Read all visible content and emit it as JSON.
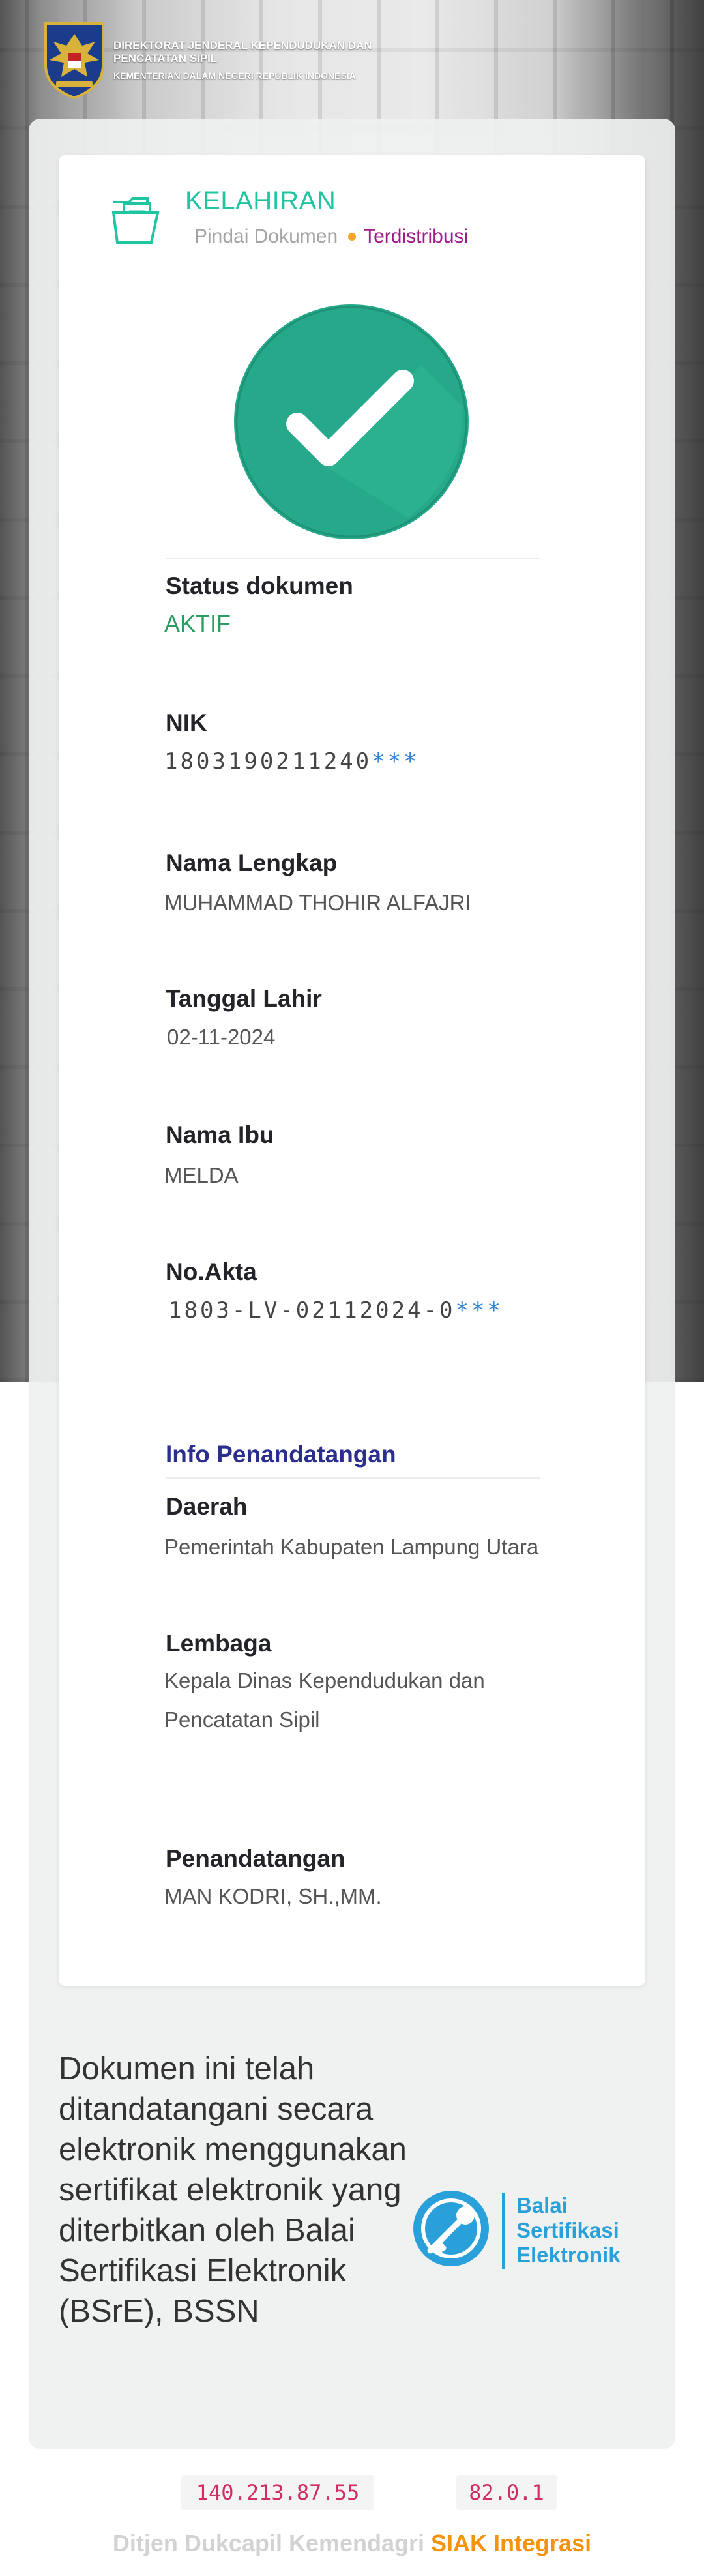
{
  "header": {
    "line1": "DIREKTORAT JENDERAL KEPENDUDUKAN DAN PENCATATAN SIPIL",
    "line2": "KEMENTERIAN DALAM NEGERI REPUBLIK INDONESIA",
    "emblem_icon": "garuda-emblem-icon"
  },
  "card": {
    "title": "KELAHIRAN",
    "subtitle_a": "Pindai Dokumen",
    "subtitle_b": "Terdistribusi",
    "doc_icon": "document-folder-icon",
    "status_icon": "checkmark-icon"
  },
  "fields": {
    "status_label": "Status dokumen",
    "status_value": "AKTIF",
    "nik_label": "NIK",
    "nik_value": "1803190211240",
    "nik_mask": "***",
    "nama_label": "Nama Lengkap",
    "nama_value": "MUHAMMAD THOHIR ALFAJRI",
    "tgl_label": "Tanggal Lahir",
    "tgl_value": "02-11-2024",
    "ibu_label": "Nama Ibu",
    "ibu_value": "MELDA",
    "akta_label": "No.Akta",
    "akta_value": "1803-LV-02112024-0",
    "akta_mask": "***"
  },
  "signing": {
    "title": "Info Penandatangan",
    "daerah_label": "Daerah",
    "daerah_value": "Pemerintah Kabupaten Lampung Utara",
    "lembaga_label": "Lembaga",
    "lembaga_value": "Kepala Dinas Kependudukan dan Pencatatan Sipil",
    "penandatangan_label": "Penandatangan",
    "penandatangan_value": "MAN KODRI, SH.,MM."
  },
  "notice": {
    "text": "Dokumen ini telah ditandatangani secara elektronik menggunakan sertifikat elektronik yang diterbitkan oleh Balai Sertifikasi Elektronik (BSrE), BSSN",
    "logo_line1": "Balai",
    "logo_line2": "Sertifikasi",
    "logo_line3": "Elektronik",
    "logo_icon": "bsre-key-icon"
  },
  "footer": {
    "ip": "140.213.87.55",
    "version": "82.0.1",
    "text_grey": "Ditjen Dukcapil Kemendagri",
    "text_orange": "SIAK Integrasi"
  },
  "colors": {
    "accent_teal": "#1fc4a0",
    "check_green": "#26a98b",
    "status_green": "#2a9d63",
    "section_navy": "#2a2f8f",
    "bsre_blue": "#2aa0db",
    "footer_orange": "#f5930f"
  }
}
